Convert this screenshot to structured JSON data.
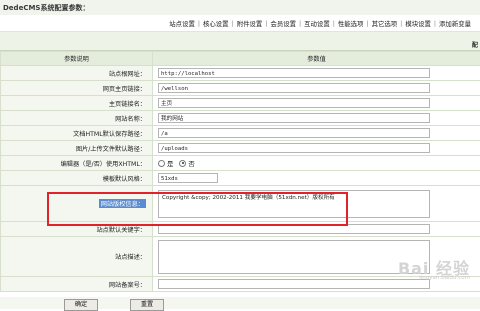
{
  "header": {
    "title": "DedeCMS系统配置参数："
  },
  "nav": {
    "items": [
      "站点设置",
      "核心设置",
      "附件设置",
      "会员设置",
      "互动设置",
      "性能选项",
      "其它选项",
      "模块设置",
      "添加新变量"
    ]
  },
  "strip": {
    "label": "配"
  },
  "table": {
    "col_label": "参数说明",
    "col_value": "参数值",
    "rows": {
      "site_url": {
        "label": "站点根网址：",
        "value": "http://localhost"
      },
      "home_link": {
        "label": "网页主页链接：",
        "value": "/wellson"
      },
      "home_name": {
        "label": "主页链接名：",
        "value": "主页"
      },
      "site_name": {
        "label": "网站名称：",
        "value": "我的网站"
      },
      "html_dir": {
        "label": "文档HTML默认保存路径：",
        "value": "/a"
      },
      "upload_dir": {
        "label": "图片/上传文件默认路径：",
        "value": "/uploads"
      },
      "editor": {
        "label": "编辑器（是/否）使用XHTML：",
        "opt_yes": "是",
        "opt_no": "否"
      },
      "template": {
        "label": "模板默认风格：",
        "value": "51xds"
      },
      "copyright": {
        "label": "网站版权信息：",
        "value": "Copyright &copy; 2002-2011  我要学电脑（51xdn.net）版权所有"
      },
      "keywords": {
        "label": "站点默认关键字：",
        "value": ""
      },
      "description": {
        "label": "站点描述：",
        "value": ""
      },
      "icp": {
        "label": "网站备案号：",
        "value": ""
      }
    }
  },
  "buttons": {
    "ok": "确定",
    "reset": "重置"
  },
  "watermark": {
    "main": "Bai 经验",
    "sub": "jingyan.baidu.com"
  },
  "colors": {
    "highlight_box": "#e0232a",
    "label_bg": "#f3f7ef",
    "header_bg": "#e4ecdc"
  }
}
